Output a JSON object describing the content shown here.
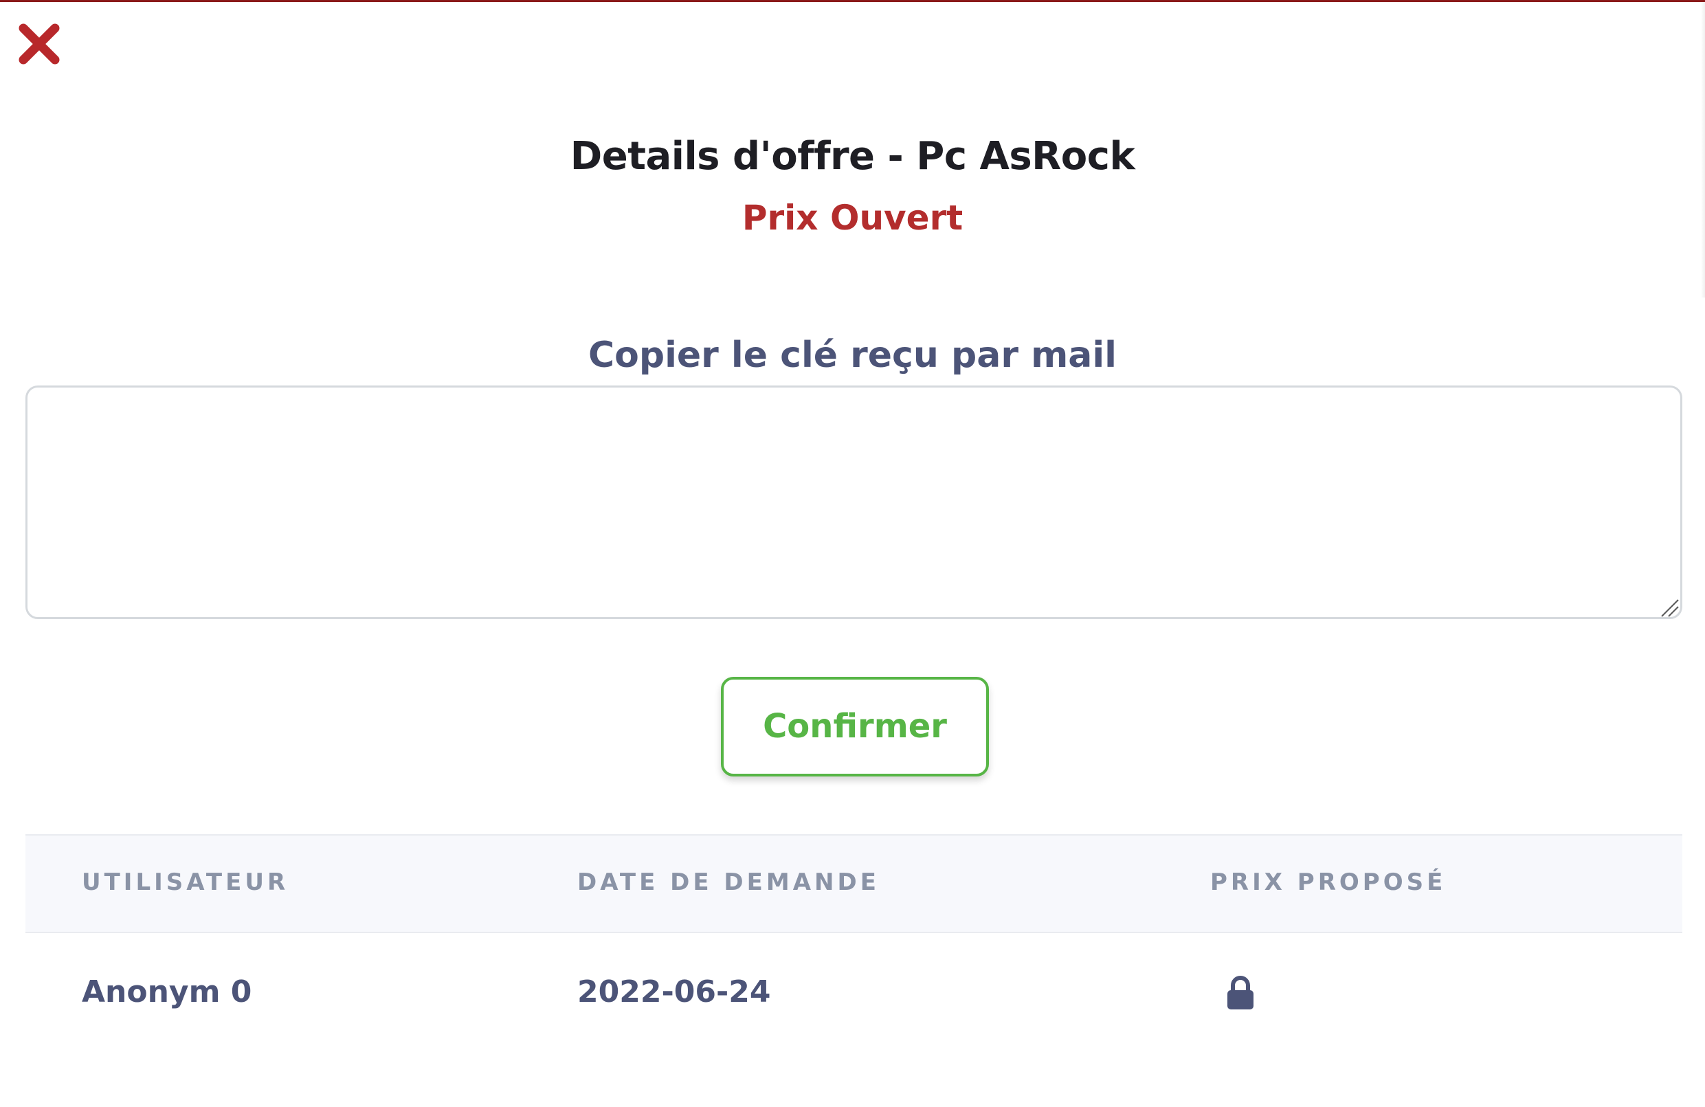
{
  "modal": {
    "close_icon": "close-x-icon",
    "title": "Details d'offre - Pc AsRock",
    "subtitle": "Prix Ouvert",
    "key_field": {
      "label": "Copier le clé reçu par mail",
      "value": "",
      "placeholder": ""
    },
    "confirm_label": "Confirmer"
  },
  "table": {
    "headers": [
      "UTILISATEUR",
      "DATE DE DEMANDE",
      "PRIX PROPOSÉ"
    ],
    "rows": [
      {
        "user": "Anonym 0",
        "date": "2022-06-24",
        "price_icon": "lock-icon"
      }
    ]
  },
  "colors": {
    "close": "#b8282b",
    "subtitle": "#b32d2d",
    "label": "#4c5478",
    "confirm": "#57b546",
    "header_bg": "#f7f8fc",
    "header_text": "#8a93a6"
  }
}
